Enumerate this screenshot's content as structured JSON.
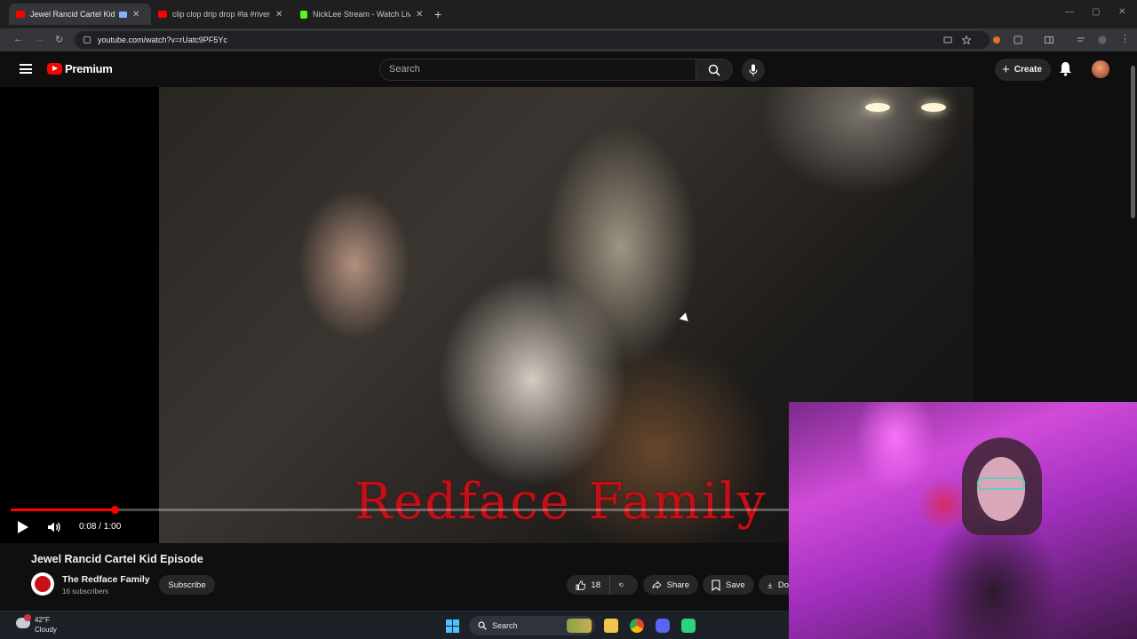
{
  "browser": {
    "tabs": [
      {
        "label": "Jewel Rancid Cartel Kid Epi",
        "active": true
      },
      {
        "label": "clip clop drip drop #la #riversid",
        "active": false
      },
      {
        "label": "NickLee Stream - Watch Live o",
        "active": false
      }
    ],
    "url": "youtube.com/watch?v=rUatc9PF5Yc"
  },
  "masthead": {
    "brand": "Premium",
    "search_placeholder": "Search",
    "create_label": "Create"
  },
  "player": {
    "watermark": "Redface Family",
    "time": "0:08 / 1:00",
    "progress_fraction": 0.133
  },
  "video": {
    "title": "Jewel Rancid Cartel Kid Episode",
    "channel": "The Redface Family",
    "subscribers": "16 subscribers",
    "subscribe_label": "Subscribe",
    "likes": "18",
    "share_label": "Share",
    "save_label": "Save",
    "download_label": "Do"
  },
  "taskbar": {
    "temperature": "42°F",
    "condition": "Cloudy",
    "search_label": "Search"
  },
  "colors": {
    "accent_red": "#ff0000",
    "background": "#0f0f0f",
    "watermark_red": "#c0111b"
  }
}
